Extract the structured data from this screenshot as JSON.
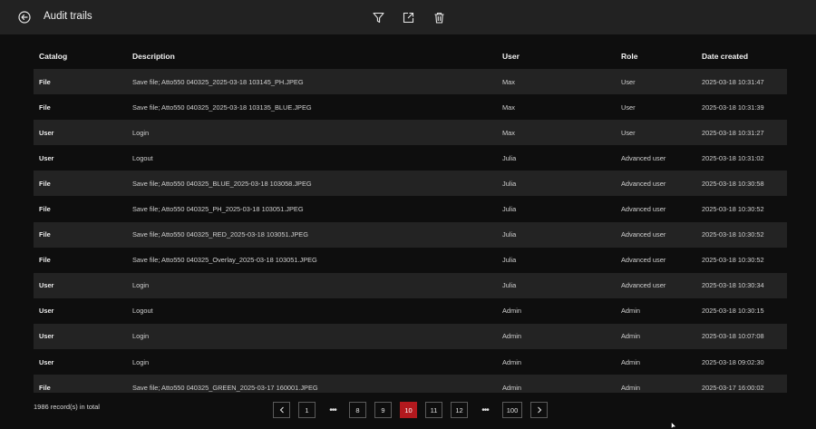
{
  "header": {
    "title": "Audit trails",
    "icons": [
      "back-icon",
      "filter-icon",
      "export-icon",
      "trash-icon"
    ]
  },
  "table": {
    "columns": [
      "Catalog",
      "Description",
      "User",
      "Role",
      "Date created"
    ],
    "rows": [
      {
        "catalog": "File",
        "description": "Save file; Atto550 040325_2025-03-18 103145_PH.JPEG",
        "user": "Max",
        "role": "User",
        "date": "2025-03-18 10:31:47"
      },
      {
        "catalog": "File",
        "description": "Save file; Atto550 040325_2025-03-18 103135_BLUE.JPEG",
        "user": "Max",
        "role": "User",
        "date": "2025-03-18 10:31:39"
      },
      {
        "catalog": "User",
        "description": "Login",
        "user": "Max",
        "role": "User",
        "date": "2025-03-18 10:31:27"
      },
      {
        "catalog": "User",
        "description": "Logout",
        "user": "Julia",
        "role": "Advanced user",
        "date": "2025-03-18 10:31:02"
      },
      {
        "catalog": "File",
        "description": "Save file; Atto550 040325_BLUE_2025-03-18 103058.JPEG",
        "user": "Julia",
        "role": "Advanced user",
        "date": "2025-03-18 10:30:58"
      },
      {
        "catalog": "File",
        "description": "Save file; Atto550 040325_PH_2025-03-18 103051.JPEG",
        "user": "Julia",
        "role": "Advanced user",
        "date": "2025-03-18 10:30:52"
      },
      {
        "catalog": "File",
        "description": "Save file; Atto550 040325_RED_2025-03-18 103051.JPEG",
        "user": "Julia",
        "role": "Advanced user",
        "date": "2025-03-18 10:30:52"
      },
      {
        "catalog": "File",
        "description": "Save file; Atto550 040325_Overlay_2025-03-18 103051.JPEG",
        "user": "Julia",
        "role": "Advanced user",
        "date": "2025-03-18 10:30:52"
      },
      {
        "catalog": "User",
        "description": "Login",
        "user": "Julia",
        "role": "Advanced user",
        "date": "2025-03-18 10:30:34"
      },
      {
        "catalog": "User",
        "description": "Logout",
        "user": "Admin",
        "role": "Admin",
        "date": "2025-03-18 10:30:15"
      },
      {
        "catalog": "User",
        "description": "Login",
        "user": "Admin",
        "role": "Admin",
        "date": "2025-03-18 10:07:08"
      },
      {
        "catalog": "User",
        "description": "Login",
        "user": "Admin",
        "role": "Admin",
        "date": "2025-03-18 09:02:30"
      },
      {
        "catalog": "File",
        "description": "Save file; Atto550 040325_GREEN_2025-03-17 160001.JPEG",
        "user": "Admin",
        "role": "Admin",
        "date": "2025-03-17 16:00:02"
      }
    ]
  },
  "footer": {
    "total_text": "1986 record(s) in total",
    "pagination": {
      "first": "1",
      "ellipsis": "•••",
      "pages": [
        "8",
        "9",
        "10",
        "11",
        "12"
      ],
      "current": "10",
      "last": "100"
    }
  },
  "colors": {
    "accent": "#b3191e",
    "topbar": "#222222",
    "row_alt": "#232323",
    "background": "#0e0e0e"
  }
}
